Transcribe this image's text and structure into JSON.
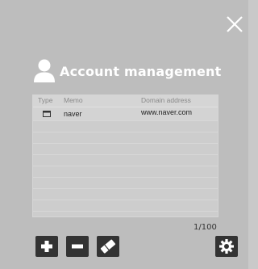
{
  "header": {
    "title": "Account management"
  },
  "table": {
    "columns": [
      "Type",
      "Memo",
      "Domain address"
    ],
    "rows": [
      {
        "icon": "document-icon",
        "memo": "naver",
        "domain": "www.naver.com"
      }
    ],
    "empty_rows": 8
  },
  "pager": {
    "text": "1/100"
  },
  "icons": {
    "close": "close-icon",
    "user": "user-icon",
    "add": "plus-icon",
    "remove": "minus-icon",
    "erase": "eraser-icon",
    "settings": "gear-icon"
  },
  "colors": {
    "background": "#bdbdbd",
    "button": "#333333",
    "title": "#ffffff"
  }
}
